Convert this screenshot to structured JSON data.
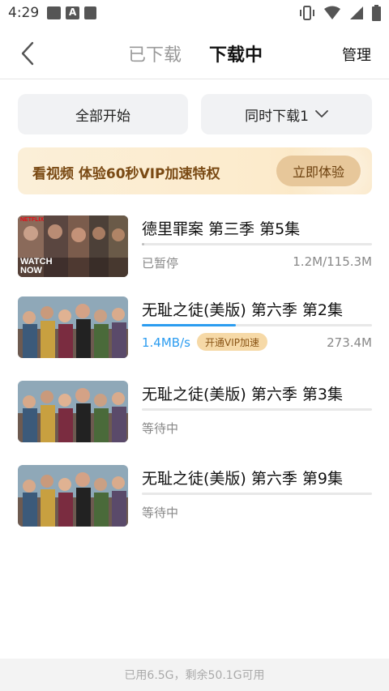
{
  "status_bar": {
    "time": "4:29",
    "left_icons": [
      "tvb-app-icon",
      "a-app-icon",
      "book-app-icon"
    ],
    "right_icons": [
      "vibrate-icon",
      "wifi-icon",
      "signal-icon",
      "battery-icon"
    ]
  },
  "nav": {
    "back_icon": "chevron-left-icon",
    "tab_downloaded": "已下载",
    "tab_downloading": "下载中",
    "manage": "管理"
  },
  "actions": {
    "start_all": "全部开始",
    "simultaneous": "同时下载1",
    "simultaneous_icon": "chevron-down-icon"
  },
  "vip_banner": {
    "text": "看视频 体验60秒VIP加速特权",
    "button": "立即体验"
  },
  "downloads": [
    {
      "title": "德里罪案 第三季 第5集",
      "status": "已暂停",
      "size": "1.2M/115.3M",
      "progress": 0.01,
      "thumb_label_1": "NETFLIX",
      "thumb_label_2": "WATCH",
      "thumb_label_3": "NOW"
    },
    {
      "title": "无耻之徒(美版) 第六季 第2集",
      "status": "1.4MB/s",
      "vip_tag": "开通VIP加速",
      "size": "273.4M",
      "progress": 0.41
    },
    {
      "title": "无耻之徒(美版) 第六季 第3集",
      "status": "等待中",
      "progress": 0
    },
    {
      "title": "无耻之徒(美版) 第六季 第9集",
      "status": "等待中",
      "progress": 0
    }
  ],
  "footer": {
    "storage": "已用6.5G，剩余50.1G可用"
  },
  "colors": {
    "accent_blue": "#2b9cf0",
    "vip_gold": "#e7c79a",
    "vip_text": "#7a4a14"
  }
}
